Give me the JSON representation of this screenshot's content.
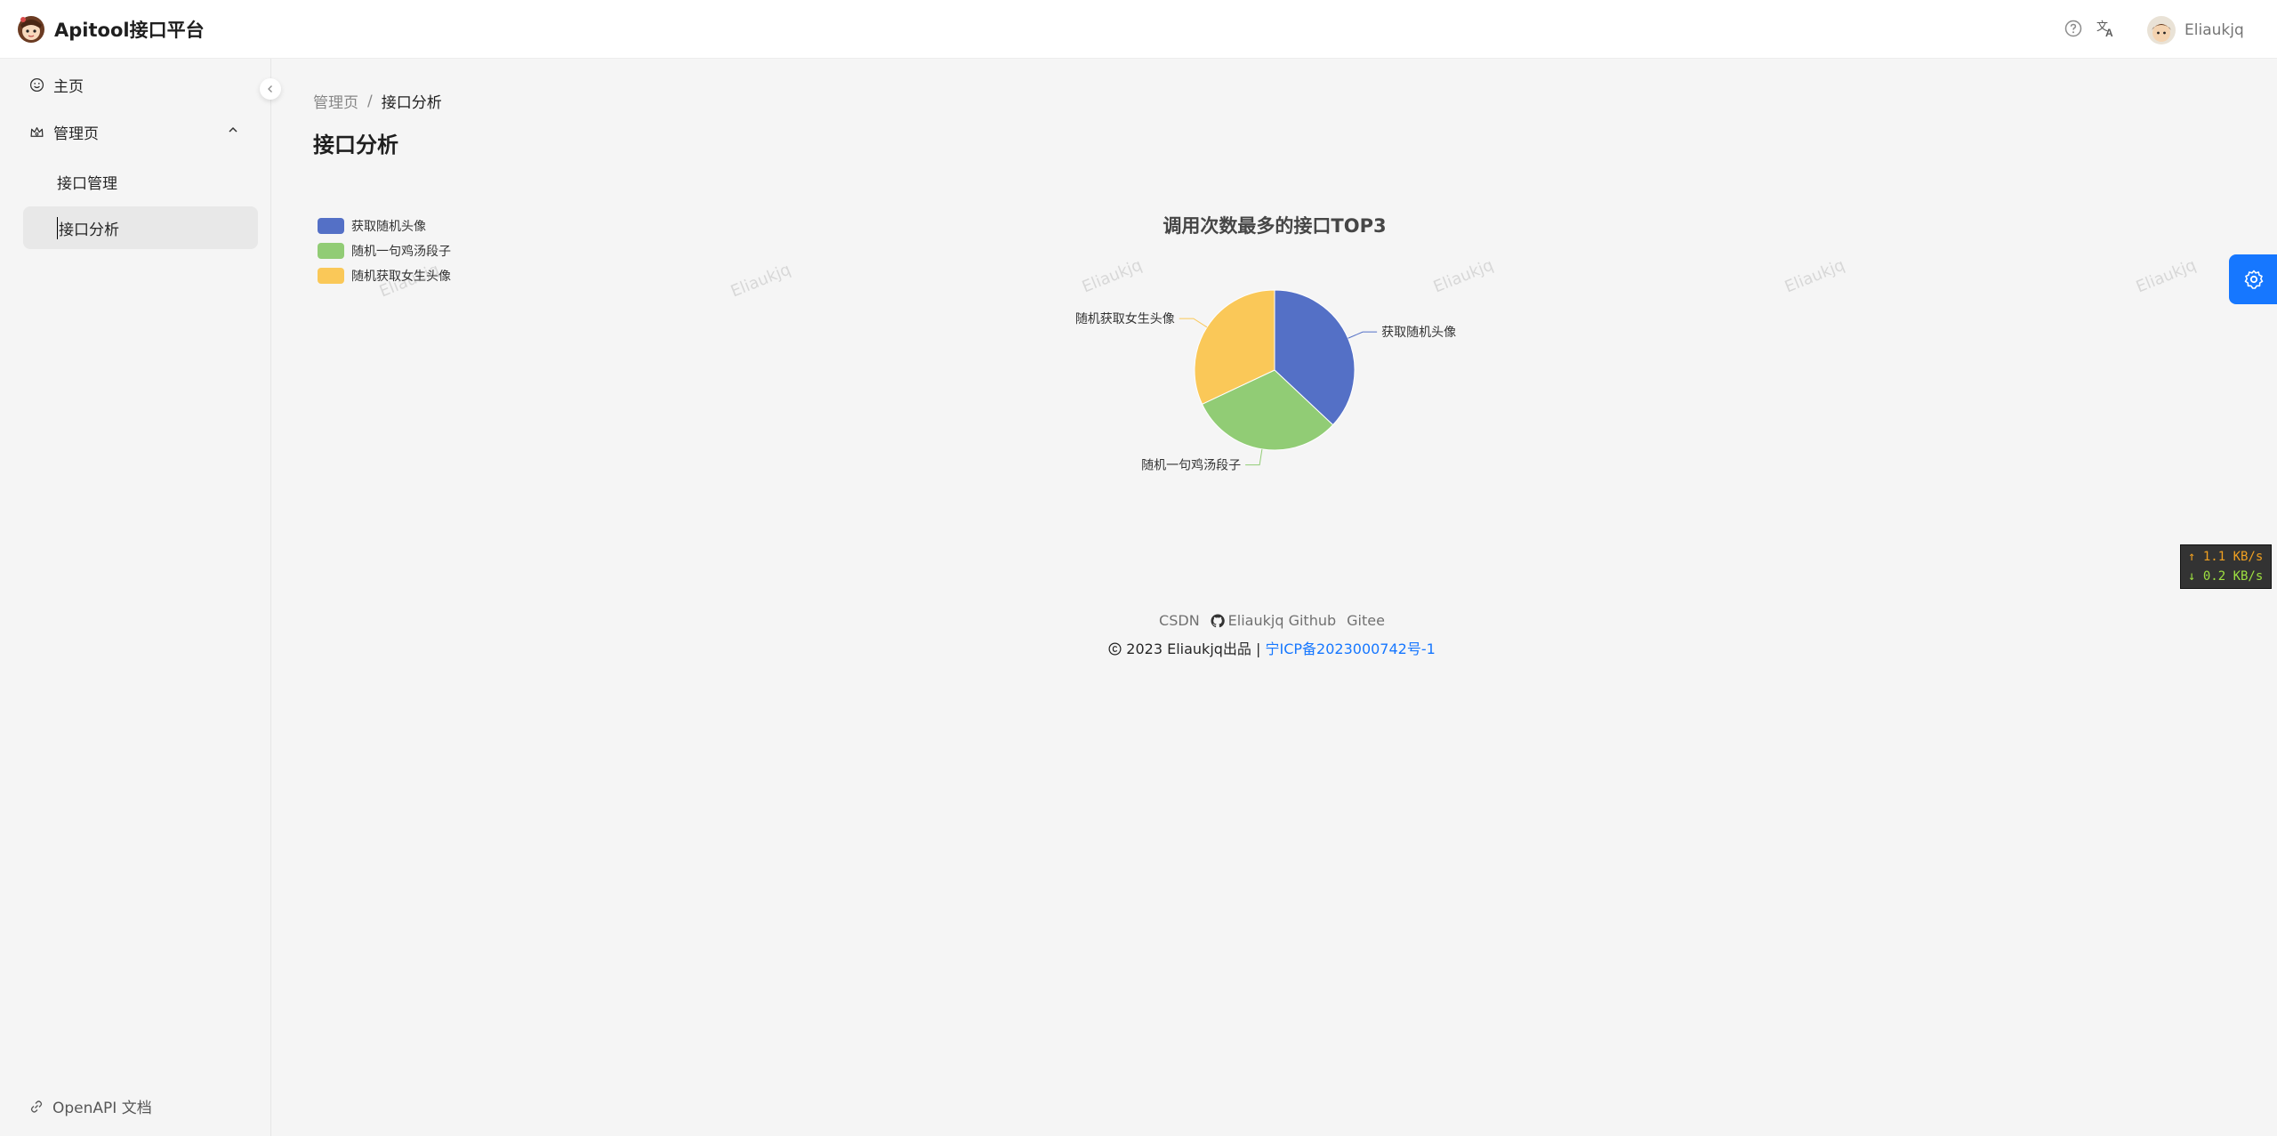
{
  "header": {
    "app_title": "Apitool接口平台",
    "user_name": "Eliaukjq"
  },
  "sidebar": {
    "items": [
      {
        "label": "主页",
        "icon": "smile-icon"
      },
      {
        "label": "管理页",
        "icon": "crown-icon"
      },
      {
        "label": "接口管理"
      },
      {
        "label": "接口分析"
      }
    ],
    "bottom_link": "OpenAPI 文档"
  },
  "breadcrumb": {
    "parent": "管理页",
    "separator": "/",
    "current": "接口分析"
  },
  "page_title": "接口分析",
  "watermark_text": "Eliaukjq",
  "chart_data": {
    "type": "pie",
    "title": "调用次数最多的接口TOP3",
    "legend_position": "top-left",
    "slices": [
      {
        "name": "获取随机头像",
        "value": 37,
        "color": "#5470c6"
      },
      {
        "name": "随机一句鸡汤段子",
        "value": 31,
        "color": "#91cc75"
      },
      {
        "name": "随机获取女生头像",
        "value": 32,
        "color": "#fac858"
      }
    ]
  },
  "network_speed": {
    "up": "↑ 1.1 KB/s",
    "down": "↓ 0.2 KB/s"
  },
  "footer": {
    "links": [
      "CSDN",
      "Eliaukjq Github",
      "Gitee"
    ],
    "copyright": "2023 Eliaukjq出品 |",
    "icp": "宁ICP备2023000742号-1"
  },
  "colors": {
    "primary": "#1677ff",
    "header_bg": "#ffffff",
    "page_bg": "#f5f5f5"
  }
}
